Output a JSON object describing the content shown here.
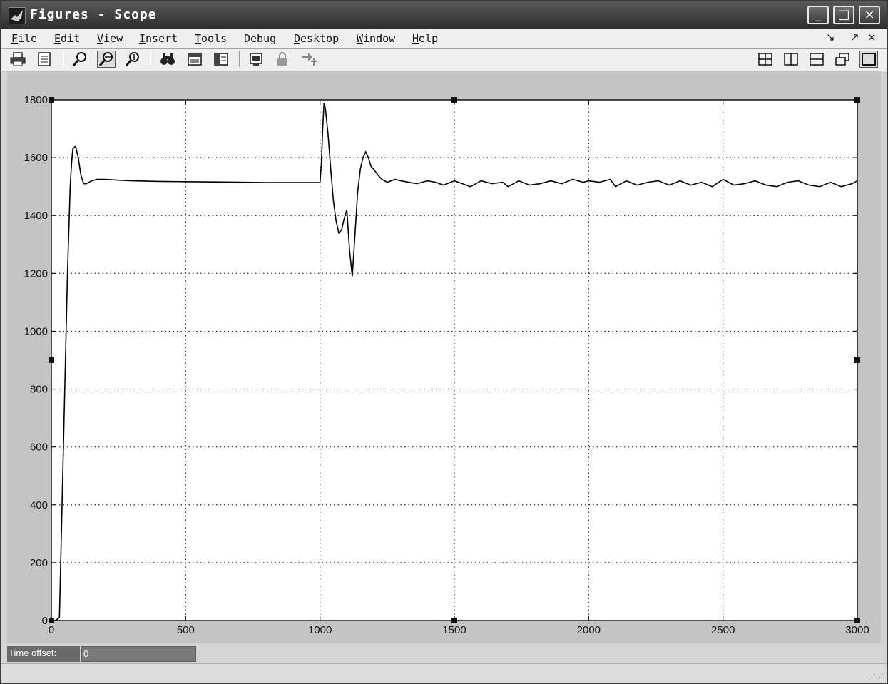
{
  "window": {
    "title": "Figures - Scope",
    "controls": {
      "minimize": "_",
      "maximize": "□",
      "close": "×"
    }
  },
  "menubar": {
    "items": [
      {
        "label": "File",
        "mnemonic": "F",
        "rest": "ile"
      },
      {
        "label": "Edit",
        "mnemonic": "E",
        "rest": "dit"
      },
      {
        "label": "View",
        "mnemonic": "V",
        "rest": "iew"
      },
      {
        "label": "Insert",
        "mnemonic": "I",
        "rest": "nsert"
      },
      {
        "label": "Tools",
        "mnemonic": "T",
        "rest": "ools"
      },
      {
        "label": "Debug",
        "mnemonic": "Debu",
        "rest": "g",
        "underline_last": true
      },
      {
        "label": "Desktop",
        "mnemonic": "D",
        "rest": "esktop"
      },
      {
        "label": "Window",
        "mnemonic": "W",
        "rest": "indow"
      },
      {
        "label": "Help",
        "mnemonic": "H",
        "rest": "elp"
      }
    ],
    "right_controls": {
      "undock": "↘",
      "restore": "↗",
      "close": "×"
    }
  },
  "toolbar": {
    "buttons": [
      "print-icon",
      "print-preview-icon",
      "zoom-in-icon",
      "zoom-x-icon",
      "zoom-y-icon",
      "autoscale-icon",
      "save-axes-icon",
      "restore-axes-icon",
      "parameters-icon",
      "lock-icon",
      "signal-selection-icon",
      "layout-2x2-icon",
      "layout-1x2-icon",
      "layout-2x1-icon",
      "float-icon",
      "single-axes-icon"
    ]
  },
  "time_offset": {
    "label": "Time offset:",
    "value": "0"
  },
  "chart_data": {
    "type": "line",
    "title": "",
    "xlabel": "",
    "ylabel": "",
    "xlim": [
      0,
      3000
    ],
    "ylim": [
      0,
      1800
    ],
    "xticks": [
      0,
      500,
      1000,
      1500,
      2000,
      2500,
      3000
    ],
    "yticks": [
      0,
      200,
      400,
      600,
      800,
      1000,
      1200,
      1400,
      1600,
      1800
    ],
    "grid": true,
    "series": [
      {
        "color": "#000000",
        "x": [
          0,
          15,
          30,
          50,
          60,
          70,
          75,
          80,
          90,
          100,
          110,
          120,
          130,
          150,
          170,
          200,
          250,
          300,
          400,
          500,
          600,
          700,
          800,
          900,
          1000,
          1005,
          1010,
          1015,
          1020,
          1030,
          1040,
          1050,
          1060,
          1070,
          1080,
          1090,
          1100,
          1110,
          1120,
          1130,
          1140,
          1150,
          1160,
          1170,
          1180,
          1190,
          1200,
          1215,
          1230,
          1250,
          1280,
          1300,
          1330,
          1360,
          1400,
          1430,
          1460,
          1500,
          1530,
          1560,
          1600,
          1640,
          1680,
          1700,
          1740,
          1780,
          1820,
          1860,
          1900,
          1940,
          1980,
          2000,
          2040,
          2080,
          2100,
          2140,
          2180,
          2220,
          2260,
          2300,
          2340,
          2380,
          2420,
          2460,
          2500,
          2540,
          2580,
          2620,
          2660,
          2700,
          2740,
          2780,
          2820,
          2860,
          2900,
          2940,
          2980,
          3000
        ],
        "y": [
          0,
          0,
          10,
          800,
          1200,
          1500,
          1580,
          1630,
          1640,
          1600,
          1540,
          1510,
          1510,
          1520,
          1525,
          1525,
          1522,
          1520,
          1518,
          1517,
          1516,
          1515,
          1514,
          1514,
          1514,
          1580,
          1700,
          1790,
          1770,
          1680,
          1560,
          1450,
          1380,
          1340,
          1350,
          1390,
          1420,
          1280,
          1190,
          1330,
          1480,
          1560,
          1600,
          1620,
          1600,
          1570,
          1560,
          1540,
          1525,
          1515,
          1525,
          1520,
          1515,
          1510,
          1520,
          1515,
          1505,
          1520,
          1510,
          1500,
          1520,
          1510,
          1515,
          1500,
          1520,
          1505,
          1510,
          1520,
          1510,
          1525,
          1515,
          1520,
          1515,
          1525,
          1500,
          1520,
          1505,
          1515,
          1520,
          1505,
          1520,
          1505,
          1515,
          1500,
          1525,
          1505,
          1510,
          1520,
          1505,
          1500,
          1515,
          1520,
          1505,
          1500,
          1515,
          1500,
          1510,
          1520
        ]
      }
    ]
  }
}
